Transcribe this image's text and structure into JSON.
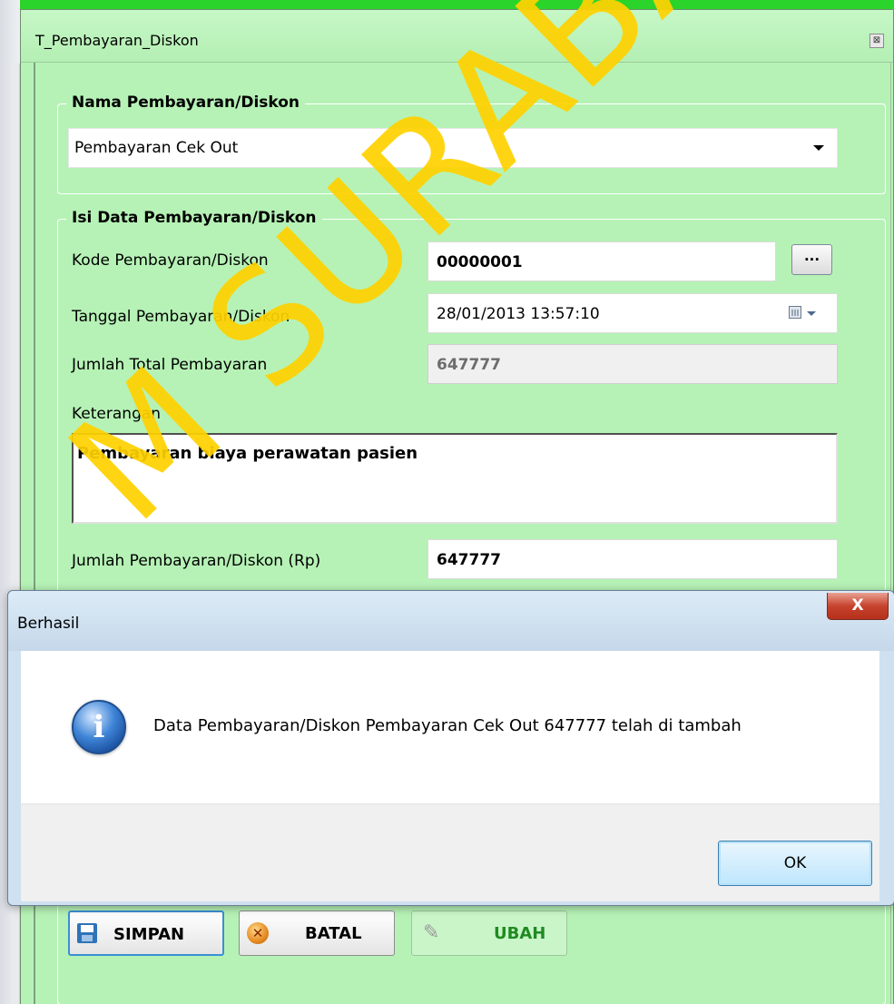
{
  "main_window": {
    "title": "T_Pembayaran_Diskon",
    "close_glyph": "⊠"
  },
  "group_nama": {
    "legend": "Nama Pembayaran/Diskon",
    "selected": "Pembayaran Cek Out"
  },
  "group_isi": {
    "legend": "Isi Data Pembayaran/Diskon",
    "kode_label": "Kode Pembayaran/Diskon",
    "kode_value": "00000001",
    "lookup_button": "...",
    "tanggal_label": "Tanggal Pembayaran/Diskon",
    "tanggal_value": "28/01/2013 13:57:10",
    "total_label": "Jumlah Total Pembayaran",
    "total_value": "647777",
    "keterangan_label": "Keterangan",
    "keterangan_value": "Pembayaran biaya perawatan pasien",
    "jumlah_label": "Jumlah Pembayaran/Diskon (Rp)",
    "jumlah_value": "647777"
  },
  "buttons": {
    "simpan": "SIMPAN",
    "batal": "BATAL",
    "ubah": "UBAH"
  },
  "dialog": {
    "title": "Berhasil",
    "close_glyph": "X",
    "message": "Data Pembayaran/Diskon Pembayaran Cek Out 647777 telah di tambah",
    "ok": "OK",
    "info_glyph": "i"
  },
  "watermark": "M SURABAYA",
  "colors": {
    "form_bg": "#b6f2b6",
    "watermark": "#ffd200",
    "ubah_text": "#208a20",
    "dialog_close": "#c7432d"
  },
  "icons": [
    "close-icon",
    "chevron-down-icon",
    "calendar-icon",
    "floppy-icon",
    "cancel-icon",
    "pencil-icon",
    "info-icon"
  ]
}
